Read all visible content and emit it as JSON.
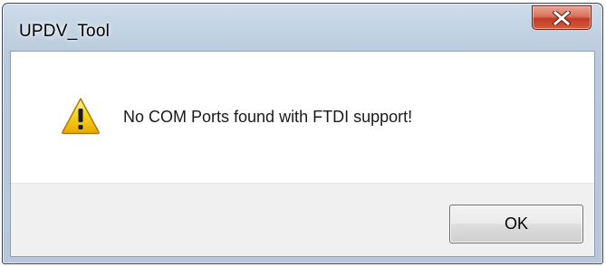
{
  "window": {
    "title": "UPDV_Tool",
    "close_icon": "close-x-icon"
  },
  "message": {
    "icon": "warning-icon",
    "text": "No COM Ports found with FTDI support!"
  },
  "buttons": {
    "ok_label": "OK"
  },
  "colors": {
    "titlebar": "#c2d2e3",
    "close_button": "#c13b25",
    "message_background": "#ffffff",
    "button_area_background": "#f0f0f0",
    "warning_yellow": "#f5c400"
  }
}
